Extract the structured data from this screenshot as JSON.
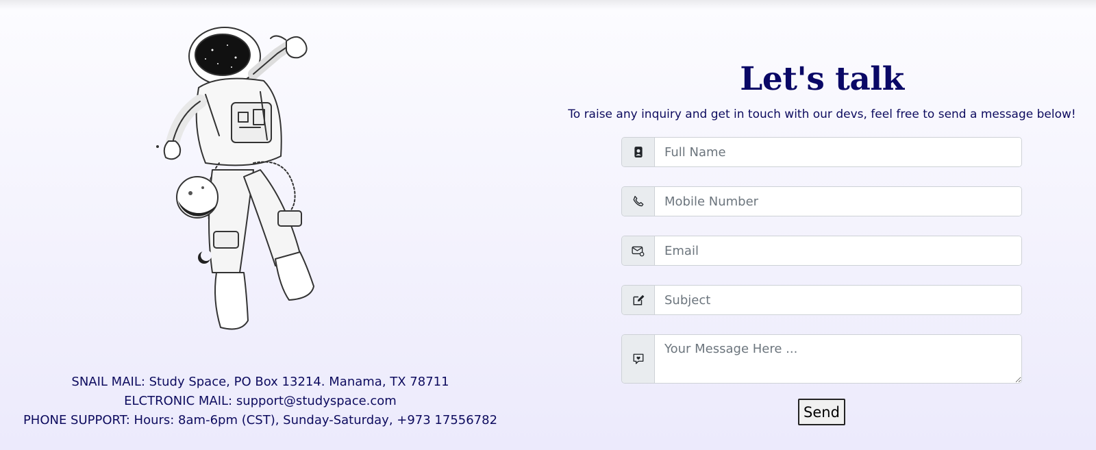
{
  "contact": {
    "title": "Let's talk",
    "subtitle": "To raise any inquiry and get in touch with our devs, feel free to send a message below!",
    "fields": {
      "name": {
        "placeholder": "Full Name",
        "icon": "person-card-icon"
      },
      "mobile": {
        "placeholder": "Mobile Number",
        "icon": "phone-icon"
      },
      "email": {
        "placeholder": "Email",
        "icon": "envelope-at-icon"
      },
      "subject": {
        "placeholder": "Subject",
        "icon": "pencil-square-icon"
      },
      "message": {
        "placeholder": "Your Message Here ...",
        "icon": "chat-heart-icon"
      }
    },
    "send_label": "Send"
  },
  "info": {
    "snail_mail": "SNAIL MAIL: Study Space, PO Box 13214. Manama, TX 78711",
    "electronic_mail": "ELCTRONIC MAIL: support@studyspace.com",
    "phone_support": "PHONE SUPPORT: Hours: 8am-6pm (CST), Sunday-Saturday, +973 17556782"
  },
  "colors": {
    "heading": "#0a0866",
    "text": "#0d0b5e",
    "addon_bg": "#e9ecef",
    "border": "#cdd1d6"
  }
}
